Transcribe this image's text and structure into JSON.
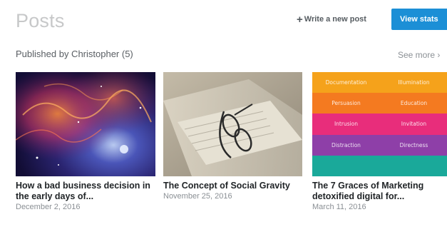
{
  "header": {
    "title": "Posts",
    "write_label": "Write a new post",
    "write_icon": "plus-icon",
    "stats_label": "View stats"
  },
  "section": {
    "label": "Published by Christopher (5)",
    "see_more": "See more"
  },
  "posts": [
    {
      "title": "How a bad business decision in the early days of...",
      "date": "December 2, 2016",
      "image": "galaxy-nebula-image"
    },
    {
      "title": "The Concept of Social Gravity",
      "date": "November 25, 2016",
      "image": "newspaper-glasses-image"
    },
    {
      "title": "The 7 Graces of Marketing detoxified digital for...",
      "date": "March 11, 2016",
      "image": "colored-word-grid-image",
      "image_words": [
        [
          "Documentation",
          "Illumination"
        ],
        [
          "Persuasion",
          "Education"
        ],
        [
          "Intrusion",
          "Invitation"
        ],
        [
          "Distraction",
          "Directness"
        ]
      ]
    }
  ],
  "colors": {
    "accent": "#1c8fd6",
    "title": "#c7c8c9",
    "grid_rows": [
      "#f5a21b",
      "#f47a20",
      "#e82d7b",
      "#8e3fa8",
      "#1aa99a"
    ]
  }
}
